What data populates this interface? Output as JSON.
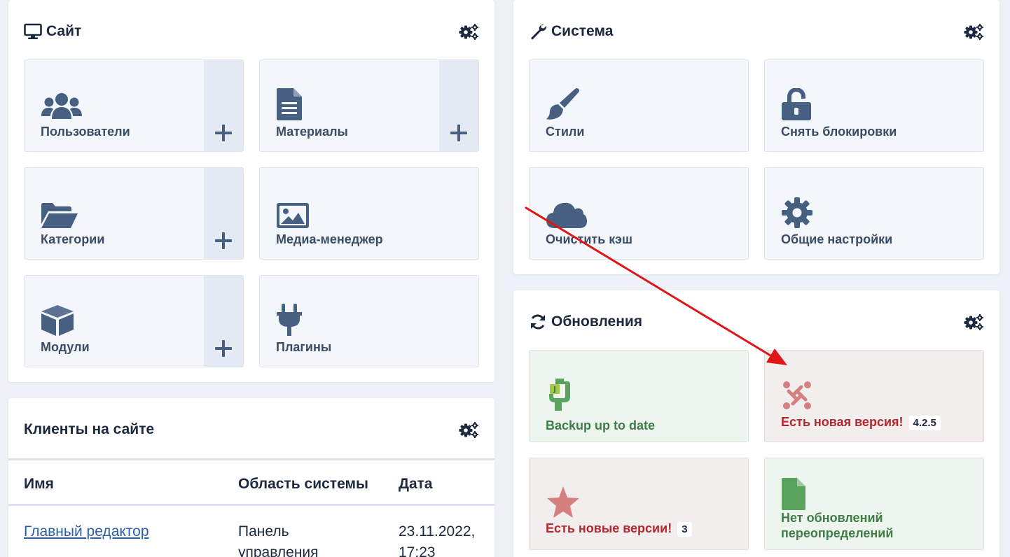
{
  "site_panel": {
    "title": "Сайт",
    "tiles": [
      {
        "label": "Пользователи"
      },
      {
        "label": "Материалы"
      },
      {
        "label": "Категории"
      },
      {
        "label": "Медиа-менеджер"
      },
      {
        "label": "Модули"
      },
      {
        "label": "Плагины"
      }
    ]
  },
  "system_panel": {
    "title": "Система",
    "tiles": [
      {
        "label": "Стили"
      },
      {
        "label": "Снять блокировки"
      },
      {
        "label": "Очистить кэш"
      },
      {
        "label": "Общие настройки"
      }
    ]
  },
  "updates_panel": {
    "title": "Обновления",
    "tiles": [
      {
        "label": "Backup up to date"
      },
      {
        "label": "Есть новая версия!",
        "badge": "4.2.5"
      },
      {
        "label": "Есть новые версии!",
        "badge": "3"
      },
      {
        "label": "Нет обновлений переопределений"
      }
    ]
  },
  "clients_panel": {
    "title": "Клиенты на сайте",
    "columns": [
      "Имя",
      "Область системы",
      "Дата"
    ],
    "rows": [
      {
        "name": "Главный редактор",
        "area": "Панель управления",
        "date": "23.11.2022, 17:23"
      }
    ]
  },
  "colors": {
    "icon": "#475f80",
    "success": "#3f7d47",
    "danger": "#b3272d",
    "arrow": "#e01515"
  }
}
